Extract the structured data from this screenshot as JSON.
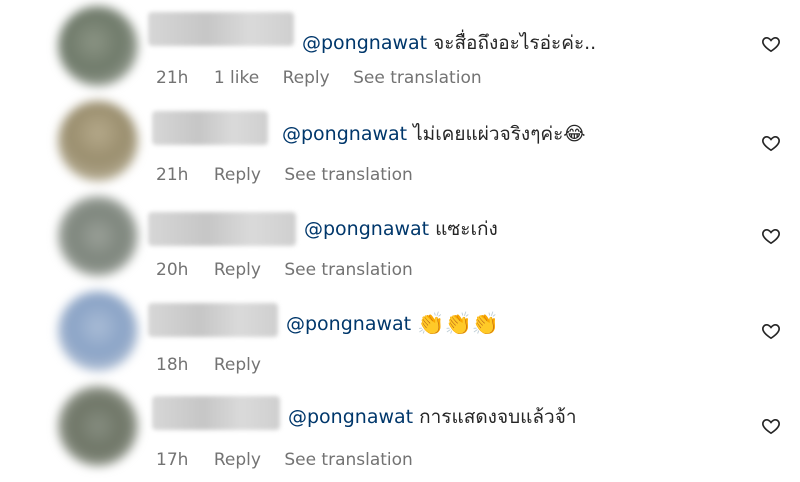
{
  "comments": [
    {
      "mention": "@pongnawat",
      "text": "จะสื่อถึงอะไรอ่ะค่ะ..",
      "time": "21h",
      "likes": "1 like",
      "reply": "Reply",
      "translate": "See translation",
      "avatar_color": "#6f7a6a"
    },
    {
      "mention": "@pongnawat",
      "text": "ไม่เคยแผ่วจริงๆค่ะ😂",
      "time": "21h",
      "likes": "",
      "reply": "Reply",
      "translate": "See translation",
      "avatar_color": "#9a8e6e"
    },
    {
      "mention": "@pongnawat",
      "text": "แซะเก่ง",
      "time": "20h",
      "likes": "",
      "reply": "Reply",
      "translate": "See translation",
      "avatar_color": "#7d857c"
    },
    {
      "mention": "@pongnawat",
      "text": "👏👏👏",
      "time": "18h",
      "likes": "",
      "reply": "Reply",
      "translate": "",
      "avatar_color": "#8aa3c6"
    },
    {
      "mention": "@pongnawat",
      "text": "การแสดงจบแล้วจ้า",
      "time": "17h",
      "likes": "",
      "reply": "Reply",
      "translate": "See translation",
      "avatar_color": "#6e7566"
    }
  ],
  "icons": {
    "like": "heart-outline-icon"
  },
  "colors": {
    "mention": "#00376b",
    "meta": "#737373",
    "text": "#262626"
  }
}
